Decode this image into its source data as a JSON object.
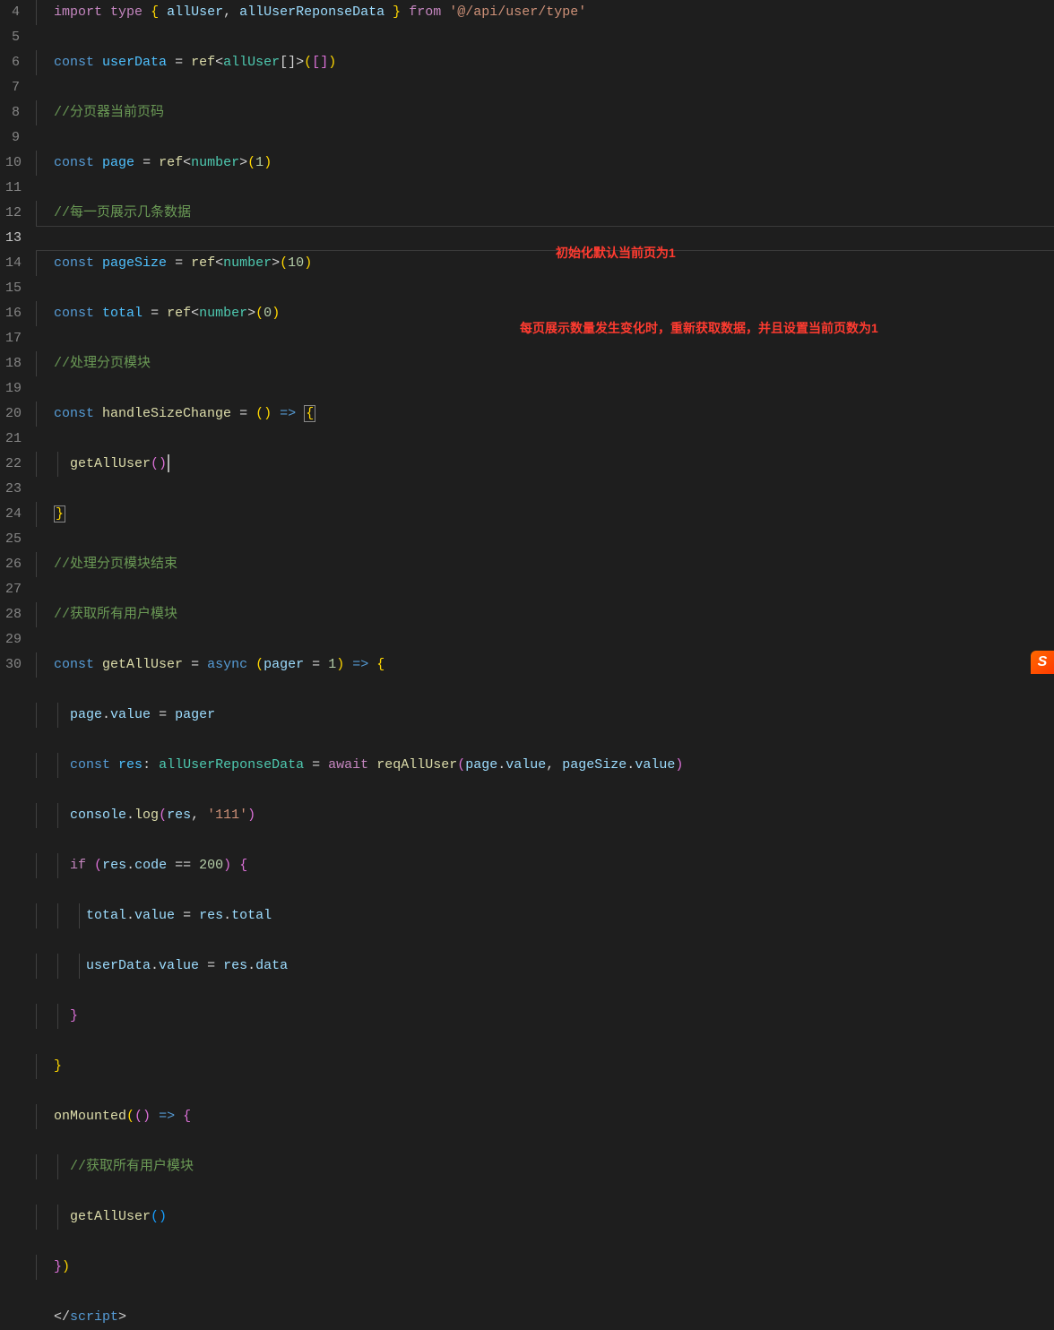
{
  "lineStart": 4,
  "lineEnd": 30,
  "activeLine": 13,
  "annotations": {
    "a1": "初始化默认当前页为1",
    "a2": "每页展示数量发生变化时，重新获取数据，并且设置当前页数为1"
  },
  "badge": "S",
  "code": {
    "l4": {
      "t": [
        {
          "c": "kw-purple",
          "v": "import"
        },
        {
          "c": "white",
          "v": " "
        },
        {
          "c": "kw-purple",
          "v": "type"
        },
        {
          "c": "white",
          "v": " "
        },
        {
          "c": "bracket-y",
          "v": "{"
        },
        {
          "c": "white",
          "v": " "
        },
        {
          "c": "ident",
          "v": "allUser"
        },
        {
          "c": "punct",
          "v": ", "
        },
        {
          "c": "ident",
          "v": "allUserReponseData"
        },
        {
          "c": "white",
          "v": " "
        },
        {
          "c": "bracket-y",
          "v": "}"
        },
        {
          "c": "white",
          "v": " "
        },
        {
          "c": "kw-purple",
          "v": "from"
        },
        {
          "c": "white",
          "v": " "
        },
        {
          "c": "str",
          "v": "'@/api/user/type'"
        }
      ]
    },
    "l5": {
      "t": [
        {
          "c": "kw-blue",
          "v": "const"
        },
        {
          "c": "white",
          "v": " "
        },
        {
          "c": "kw-bluebr",
          "v": "userData"
        },
        {
          "c": "white",
          "v": " "
        },
        {
          "c": "punct",
          "v": "="
        },
        {
          "c": "white",
          "v": " "
        },
        {
          "c": "func",
          "v": "ref"
        },
        {
          "c": "punct",
          "v": "<"
        },
        {
          "c": "type",
          "v": "allUser"
        },
        {
          "c": "punct",
          "v": "[]>"
        },
        {
          "c": "bracket-y",
          "v": "("
        },
        {
          "c": "bracket-p",
          "v": "["
        },
        {
          "c": "bracket-p",
          "v": "]"
        },
        {
          "c": "bracket-y",
          "v": ")"
        }
      ]
    },
    "l6": {
      "t": [
        {
          "c": "comment",
          "v": "//分页器当前页码"
        }
      ]
    },
    "l7": {
      "t": [
        {
          "c": "kw-blue",
          "v": "const"
        },
        {
          "c": "white",
          "v": " "
        },
        {
          "c": "kw-bluebr",
          "v": "page"
        },
        {
          "c": "white",
          "v": " "
        },
        {
          "c": "punct",
          "v": "="
        },
        {
          "c": "white",
          "v": " "
        },
        {
          "c": "func",
          "v": "ref"
        },
        {
          "c": "punct",
          "v": "<"
        },
        {
          "c": "type",
          "v": "number"
        },
        {
          "c": "punct",
          "v": ">"
        },
        {
          "c": "bracket-y",
          "v": "("
        },
        {
          "c": "num",
          "v": "1"
        },
        {
          "c": "bracket-y",
          "v": ")"
        }
      ]
    },
    "l8": {
      "t": [
        {
          "c": "comment",
          "v": "//每一页展示几条数据"
        }
      ]
    },
    "l9": {
      "t": [
        {
          "c": "kw-blue",
          "v": "const"
        },
        {
          "c": "white",
          "v": " "
        },
        {
          "c": "kw-bluebr",
          "v": "pageSize"
        },
        {
          "c": "white",
          "v": " "
        },
        {
          "c": "punct",
          "v": "="
        },
        {
          "c": "white",
          "v": " "
        },
        {
          "c": "func",
          "v": "ref"
        },
        {
          "c": "punct",
          "v": "<"
        },
        {
          "c": "type",
          "v": "number"
        },
        {
          "c": "punct",
          "v": ">"
        },
        {
          "c": "bracket-y",
          "v": "("
        },
        {
          "c": "num",
          "v": "10"
        },
        {
          "c": "bracket-y",
          "v": ")"
        }
      ]
    },
    "l10": {
      "t": [
        {
          "c": "kw-blue",
          "v": "const"
        },
        {
          "c": "white",
          "v": " "
        },
        {
          "c": "kw-bluebr",
          "v": "total"
        },
        {
          "c": "white",
          "v": " "
        },
        {
          "c": "punct",
          "v": "="
        },
        {
          "c": "white",
          "v": " "
        },
        {
          "c": "func",
          "v": "ref"
        },
        {
          "c": "punct",
          "v": "<"
        },
        {
          "c": "type",
          "v": "number"
        },
        {
          "c": "punct",
          "v": ">"
        },
        {
          "c": "bracket-y",
          "v": "("
        },
        {
          "c": "num",
          "v": "0"
        },
        {
          "c": "bracket-y",
          "v": ")"
        }
      ]
    },
    "l11": {
      "t": [
        {
          "c": "comment",
          "v": "//处理分页模块"
        }
      ]
    },
    "l12": {
      "t": [
        {
          "c": "kw-blue",
          "v": "const"
        },
        {
          "c": "white",
          "v": " "
        },
        {
          "c": "func",
          "v": "handleSizeChange"
        },
        {
          "c": "white",
          "v": " "
        },
        {
          "c": "punct",
          "v": "="
        },
        {
          "c": "white",
          "v": " "
        },
        {
          "c": "bracket-y",
          "v": "("
        },
        {
          "c": "bracket-y",
          "v": ")"
        },
        {
          "c": "white",
          "v": " "
        },
        {
          "c": "kw-blue",
          "v": "=>"
        },
        {
          "c": "white",
          "v": " "
        },
        {
          "c": "bracket-y bracket-box",
          "v": "{"
        }
      ]
    },
    "l13": {
      "indent": 1,
      "t": [
        {
          "c": "func",
          "v": "getAllUser"
        },
        {
          "c": "bracket-p",
          "v": "("
        },
        {
          "c": "bracket-p",
          "v": ")"
        }
      ],
      "cursor": true
    },
    "l14": {
      "t": [
        {
          "c": "bracket-y bracket-box",
          "v": "}"
        }
      ]
    },
    "l15": {
      "t": [
        {
          "c": "comment",
          "v": "//处理分页模块结束"
        }
      ]
    },
    "l16": {
      "t": [
        {
          "c": "comment",
          "v": "//获取所有用户模块"
        }
      ]
    },
    "l17": {
      "t": [
        {
          "c": "kw-blue",
          "v": "const"
        },
        {
          "c": "white",
          "v": " "
        },
        {
          "c": "func",
          "v": "getAllUser"
        },
        {
          "c": "white",
          "v": " "
        },
        {
          "c": "punct",
          "v": "="
        },
        {
          "c": "white",
          "v": " "
        },
        {
          "c": "kw-blue",
          "v": "async"
        },
        {
          "c": "white",
          "v": " "
        },
        {
          "c": "bracket-y",
          "v": "("
        },
        {
          "c": "ident",
          "v": "pager"
        },
        {
          "c": "white",
          "v": " "
        },
        {
          "c": "punct",
          "v": "="
        },
        {
          "c": "white",
          "v": " "
        },
        {
          "c": "num",
          "v": "1"
        },
        {
          "c": "bracket-y",
          "v": ")"
        },
        {
          "c": "white",
          "v": " "
        },
        {
          "c": "kw-blue",
          "v": "=>"
        },
        {
          "c": "white",
          "v": " "
        },
        {
          "c": "bracket-y",
          "v": "{"
        }
      ]
    },
    "l18": {
      "indent": 1,
      "t": [
        {
          "c": "ident",
          "v": "page"
        },
        {
          "c": "punct",
          "v": "."
        },
        {
          "c": "ident",
          "v": "value"
        },
        {
          "c": "white",
          "v": " "
        },
        {
          "c": "punct",
          "v": "="
        },
        {
          "c": "white",
          "v": " "
        },
        {
          "c": "ident",
          "v": "pager"
        }
      ]
    },
    "l19": {
      "indent": 1,
      "t": [
        {
          "c": "kw-blue",
          "v": "const"
        },
        {
          "c": "white",
          "v": " "
        },
        {
          "c": "kw-bluebr",
          "v": "res"
        },
        {
          "c": "punct",
          "v": ": "
        },
        {
          "c": "type",
          "v": "allUserReponseData"
        },
        {
          "c": "white",
          "v": " "
        },
        {
          "c": "punct",
          "v": "="
        },
        {
          "c": "white",
          "v": " "
        },
        {
          "c": "kw-purple",
          "v": "await"
        },
        {
          "c": "white",
          "v": " "
        },
        {
          "c": "func",
          "v": "reqAllUser"
        },
        {
          "c": "bracket-p",
          "v": "("
        },
        {
          "c": "ident",
          "v": "page"
        },
        {
          "c": "punct",
          "v": "."
        },
        {
          "c": "ident",
          "v": "value"
        },
        {
          "c": "punct",
          "v": ", "
        },
        {
          "c": "ident",
          "v": "pageSize"
        },
        {
          "c": "punct",
          "v": "."
        },
        {
          "c": "ident",
          "v": "value"
        },
        {
          "c": "bracket-p",
          "v": ")"
        }
      ]
    },
    "l20": {
      "indent": 1,
      "t": [
        {
          "c": "ident",
          "v": "console"
        },
        {
          "c": "punct",
          "v": "."
        },
        {
          "c": "func",
          "v": "log"
        },
        {
          "c": "bracket-p",
          "v": "("
        },
        {
          "c": "ident",
          "v": "res"
        },
        {
          "c": "punct",
          "v": ", "
        },
        {
          "c": "str",
          "v": "'111'"
        },
        {
          "c": "bracket-p",
          "v": ")"
        }
      ]
    },
    "l21": {
      "indent": 1,
      "t": [
        {
          "c": "kw-purple",
          "v": "if"
        },
        {
          "c": "white",
          "v": " "
        },
        {
          "c": "bracket-p",
          "v": "("
        },
        {
          "c": "ident",
          "v": "res"
        },
        {
          "c": "punct",
          "v": "."
        },
        {
          "c": "ident",
          "v": "code"
        },
        {
          "c": "white",
          "v": " "
        },
        {
          "c": "punct",
          "v": "=="
        },
        {
          "c": "white",
          "v": " "
        },
        {
          "c": "num",
          "v": "200"
        },
        {
          "c": "bracket-p",
          "v": ")"
        },
        {
          "c": "white",
          "v": " "
        },
        {
          "c": "bracket-p",
          "v": "{"
        }
      ]
    },
    "l22": {
      "indent": 2,
      "t": [
        {
          "c": "ident",
          "v": "total"
        },
        {
          "c": "punct",
          "v": "."
        },
        {
          "c": "ident",
          "v": "value"
        },
        {
          "c": "white",
          "v": " "
        },
        {
          "c": "punct",
          "v": "="
        },
        {
          "c": "white",
          "v": " "
        },
        {
          "c": "ident",
          "v": "res"
        },
        {
          "c": "punct",
          "v": "."
        },
        {
          "c": "ident",
          "v": "total"
        }
      ]
    },
    "l23": {
      "indent": 2,
      "t": [
        {
          "c": "ident",
          "v": "userData"
        },
        {
          "c": "punct",
          "v": "."
        },
        {
          "c": "ident",
          "v": "value"
        },
        {
          "c": "white",
          "v": " "
        },
        {
          "c": "punct",
          "v": "="
        },
        {
          "c": "white",
          "v": " "
        },
        {
          "c": "ident",
          "v": "res"
        },
        {
          "c": "punct",
          "v": "."
        },
        {
          "c": "ident",
          "v": "data"
        }
      ]
    },
    "l24": {
      "indent": 1,
      "t": [
        {
          "c": "bracket-p",
          "v": "}"
        }
      ]
    },
    "l25": {
      "t": [
        {
          "c": "bracket-y",
          "v": "}"
        }
      ]
    },
    "l26": {
      "t": [
        {
          "c": "func",
          "v": "onMounted"
        },
        {
          "c": "bracket-y",
          "v": "("
        },
        {
          "c": "bracket-p",
          "v": "("
        },
        {
          "c": "bracket-p",
          "v": ")"
        },
        {
          "c": "white",
          "v": " "
        },
        {
          "c": "kw-blue",
          "v": "=>"
        },
        {
          "c": "white",
          "v": " "
        },
        {
          "c": "bracket-p",
          "v": "{"
        }
      ]
    },
    "l27": {
      "indent": 1,
      "t": [
        {
          "c": "comment",
          "v": "//获取所有用户模块"
        }
      ]
    },
    "l28": {
      "indent": 1,
      "t": [
        {
          "c": "func",
          "v": "getAllUser"
        },
        {
          "c": "bracket-b",
          "v": "("
        },
        {
          "c": "bracket-b",
          "v": ")"
        }
      ]
    },
    "l29": {
      "t": [
        {
          "c": "bracket-p",
          "v": "}"
        },
        {
          "c": "bracket-y",
          "v": ")"
        }
      ]
    },
    "l30": {
      "t": [
        {
          "c": "punct",
          "v": "</"
        },
        {
          "c": "kw-blue",
          "v": "script"
        },
        {
          "c": "punct",
          "v": ">"
        }
      ],
      "noBaseIndent": true
    }
  }
}
